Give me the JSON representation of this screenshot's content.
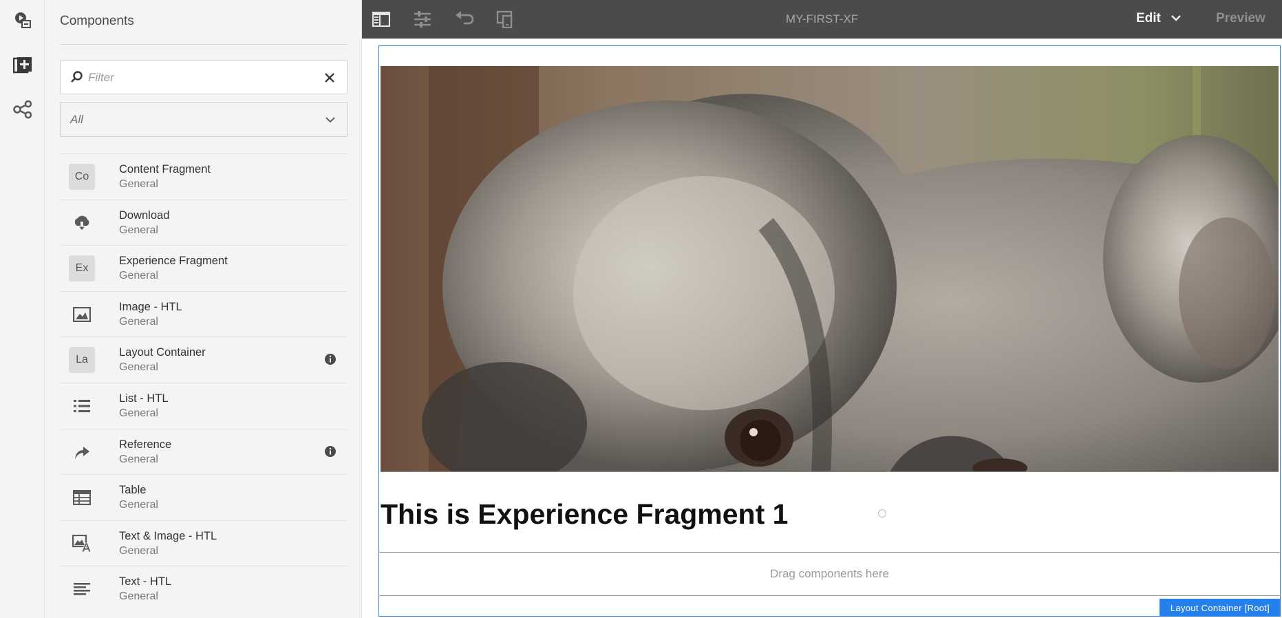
{
  "rail": {
    "items": [
      {
        "icon": "page-info-icon"
      },
      {
        "icon": "add-components-icon"
      },
      {
        "icon": "share-icon"
      }
    ]
  },
  "panel": {
    "title": "Components",
    "filter": {
      "placeholder": "Filter",
      "value": ""
    },
    "group_select": {
      "value": "All"
    },
    "components": [
      {
        "name": "Content Fragment",
        "group": "General",
        "icon": "abbr",
        "abbr": "Co",
        "info": false
      },
      {
        "name": "Download",
        "group": "General",
        "icon": "cloud-download-icon",
        "info": false
      },
      {
        "name": "Experience Fragment",
        "group": "General",
        "icon": "abbr",
        "abbr": "Ex",
        "info": false
      },
      {
        "name": "Image - HTL",
        "group": "General",
        "icon": "image-icon",
        "info": false
      },
      {
        "name": "Layout Container",
        "group": "General",
        "icon": "abbr",
        "abbr": "La",
        "info": true
      },
      {
        "name": "List - HTL",
        "group": "General",
        "icon": "list-icon",
        "info": false
      },
      {
        "name": "Reference",
        "group": "General",
        "icon": "reference-arrow-icon",
        "info": true
      },
      {
        "name": "Table",
        "group": "General",
        "icon": "table-icon",
        "info": false
      },
      {
        "name": "Text & Image - HTL",
        "group": "General",
        "icon": "text-image-icon",
        "info": false
      },
      {
        "name": "Text - HTL",
        "group": "General",
        "icon": "text-align-icon",
        "info": false
      }
    ]
  },
  "topbar": {
    "title": "MY-FIRST-XF",
    "mode": "Edit",
    "preview": "Preview",
    "tools": [
      "toggle-side-panel-icon",
      "page-properties-icon",
      "undo-icon",
      "emulator-icon"
    ]
  },
  "canvas": {
    "heading": "This is Experience Fragment 1",
    "dropzone": "Drag components here",
    "root_label": "Layout Container [Root]"
  },
  "colors": {
    "topbar": "#4b4b4b",
    "panel": "#f4f4f4",
    "accent": "#2680eb"
  }
}
